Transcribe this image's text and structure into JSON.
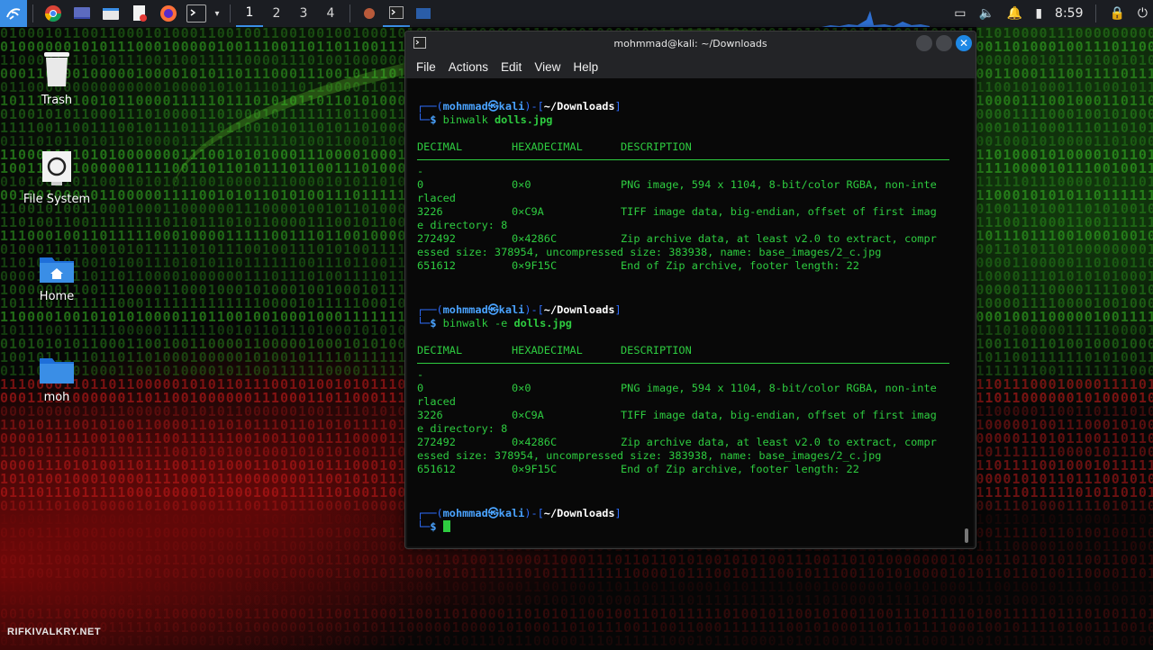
{
  "taskbar": {
    "workspaces": [
      "1",
      "2",
      "3",
      "4"
    ],
    "clock": "8:59",
    "icons": [
      "kali-menu-icon",
      "chrome-icon",
      "desktop-icon",
      "file-manager-icon",
      "text-editor-icon",
      "firefox-icon",
      "terminal-icon"
    ]
  },
  "desktop": {
    "icons": [
      {
        "label": "Trash",
        "icon": "trash-icon"
      },
      {
        "label": "File System",
        "icon": "drive-icon"
      },
      {
        "label": "Home",
        "icon": "home-folder-icon"
      },
      {
        "label": "moh",
        "icon": "folder-icon"
      }
    ],
    "watermark": "RIFKIVALKRY.NET"
  },
  "terminal": {
    "title": "mohmmad@kali: ~/Downloads",
    "menu": [
      "File",
      "Actions",
      "Edit",
      "View",
      "Help"
    ],
    "prompt": {
      "top_left": "┌──(",
      "user": "mohmmad",
      "at": "㉿",
      "host": "kali",
      "mid": ")-[",
      "dir": "~/Downloads",
      "close": "]",
      "bottom_left": "└─",
      "dollar": "$ "
    },
    "sessions": [
      {
        "command": "binwalk",
        "args": "",
        "file": "dolls.jpg",
        "headers": [
          "DECIMAL",
          "HEXADECIMAL",
          "DESCRIPTION"
        ],
        "dash": "-",
        "rows": [
          {
            "dec": "0",
            "hex": "0×0",
            "desc": "PNG image, 594 x 1104, 8-bit/color RGBA, non-inte",
            "wrap": "rlaced"
          },
          {
            "dec": "3226",
            "hex": "0×C9A",
            "desc": "TIFF image data, big-endian, offset of first imag",
            "wrap": "e directory: 8"
          },
          {
            "dec": "272492",
            "hex": "0×4286C",
            "desc": "Zip archive data, at least v2.0 to extract, compr",
            "wrap": "essed size: 378954, uncompressed size: 383938, name: base_images/2_c.jpg"
          },
          {
            "dec": "651612",
            "hex": "0×9F15C",
            "desc": "End of Zip archive, footer length: 22",
            "wrap": ""
          }
        ]
      },
      {
        "command": "binwalk",
        "args": "-e",
        "file": "dolls.jpg",
        "headers": [
          "DECIMAL",
          "HEXADECIMAL",
          "DESCRIPTION"
        ],
        "dash": "-",
        "rows": [
          {
            "dec": "0",
            "hex": "0×0",
            "desc": "PNG image, 594 x 1104, 8-bit/color RGBA, non-inte",
            "wrap": "rlaced"
          },
          {
            "dec": "3226",
            "hex": "0×C9A",
            "desc": "TIFF image data, big-endian, offset of first imag",
            "wrap": "e directory: 8"
          },
          {
            "dec": "272492",
            "hex": "0×4286C",
            "desc": "Zip archive data, at least v2.0 to extract, compr",
            "wrap": "essed size: 378954, uncompressed size: 383938, name: base_images/2_c.jpg"
          },
          {
            "dec": "651612",
            "hex": "0×9F15C",
            "desc": "End of Zip archive, footer length: 22",
            "wrap": ""
          }
        ]
      }
    ]
  },
  "colors": {
    "terminal_green": "#2ecc40",
    "prompt_blue": "#4aa3ff",
    "accent": "#3a8ee6",
    "close_button": "#1e88e5"
  }
}
